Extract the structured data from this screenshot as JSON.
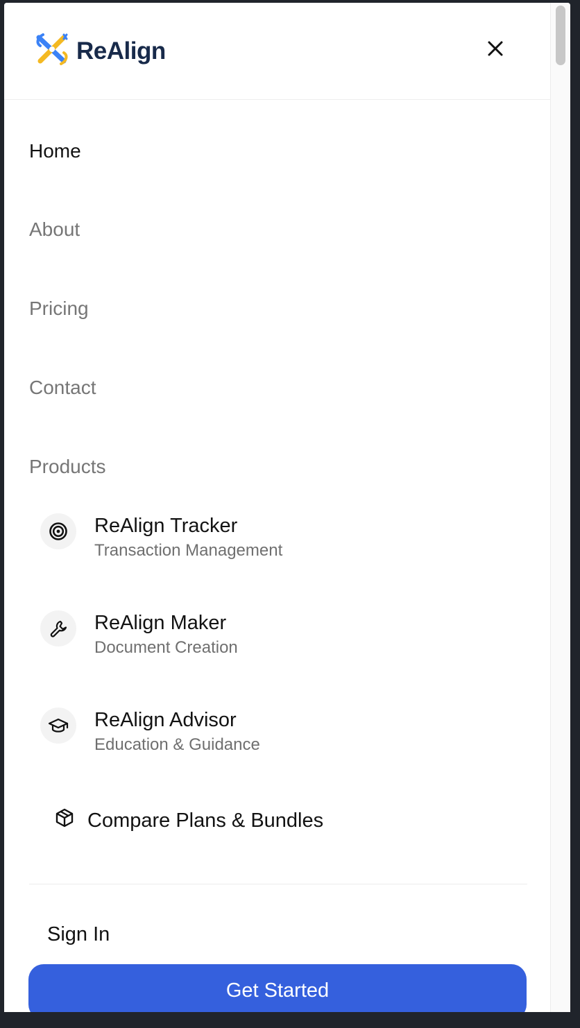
{
  "header": {
    "brand": "ReAlign",
    "logo_icon": "realign-logo-icon",
    "close_icon": "close-icon"
  },
  "nav": {
    "links": [
      {
        "label": "Home",
        "active": true
      },
      {
        "label": "About",
        "active": false
      },
      {
        "label": "Pricing",
        "active": false
      },
      {
        "label": "Contact",
        "active": false
      },
      {
        "label": "Products",
        "active": false
      }
    ]
  },
  "products": [
    {
      "title": "ReAlign Tracker",
      "subtitle": "Transaction Management",
      "icon": "target-icon"
    },
    {
      "title": "ReAlign Maker",
      "subtitle": "Document Creation",
      "icon": "wrench-icon"
    },
    {
      "title": "ReAlign Advisor",
      "subtitle": "Education & Guidance",
      "icon": "graduation-cap-icon"
    }
  ],
  "compare": {
    "label": "Compare Plans & Bundles",
    "icon": "package-icon"
  },
  "auth": {
    "sign_in": "Sign In",
    "get_started": "Get Started"
  },
  "colors": {
    "brand_navy": "#182a4a",
    "brand_yellow": "#f4b922",
    "brand_blue": "#3b82f6",
    "cta": "#3560dd",
    "muted_text": "#767676",
    "frame": "#20242b"
  }
}
